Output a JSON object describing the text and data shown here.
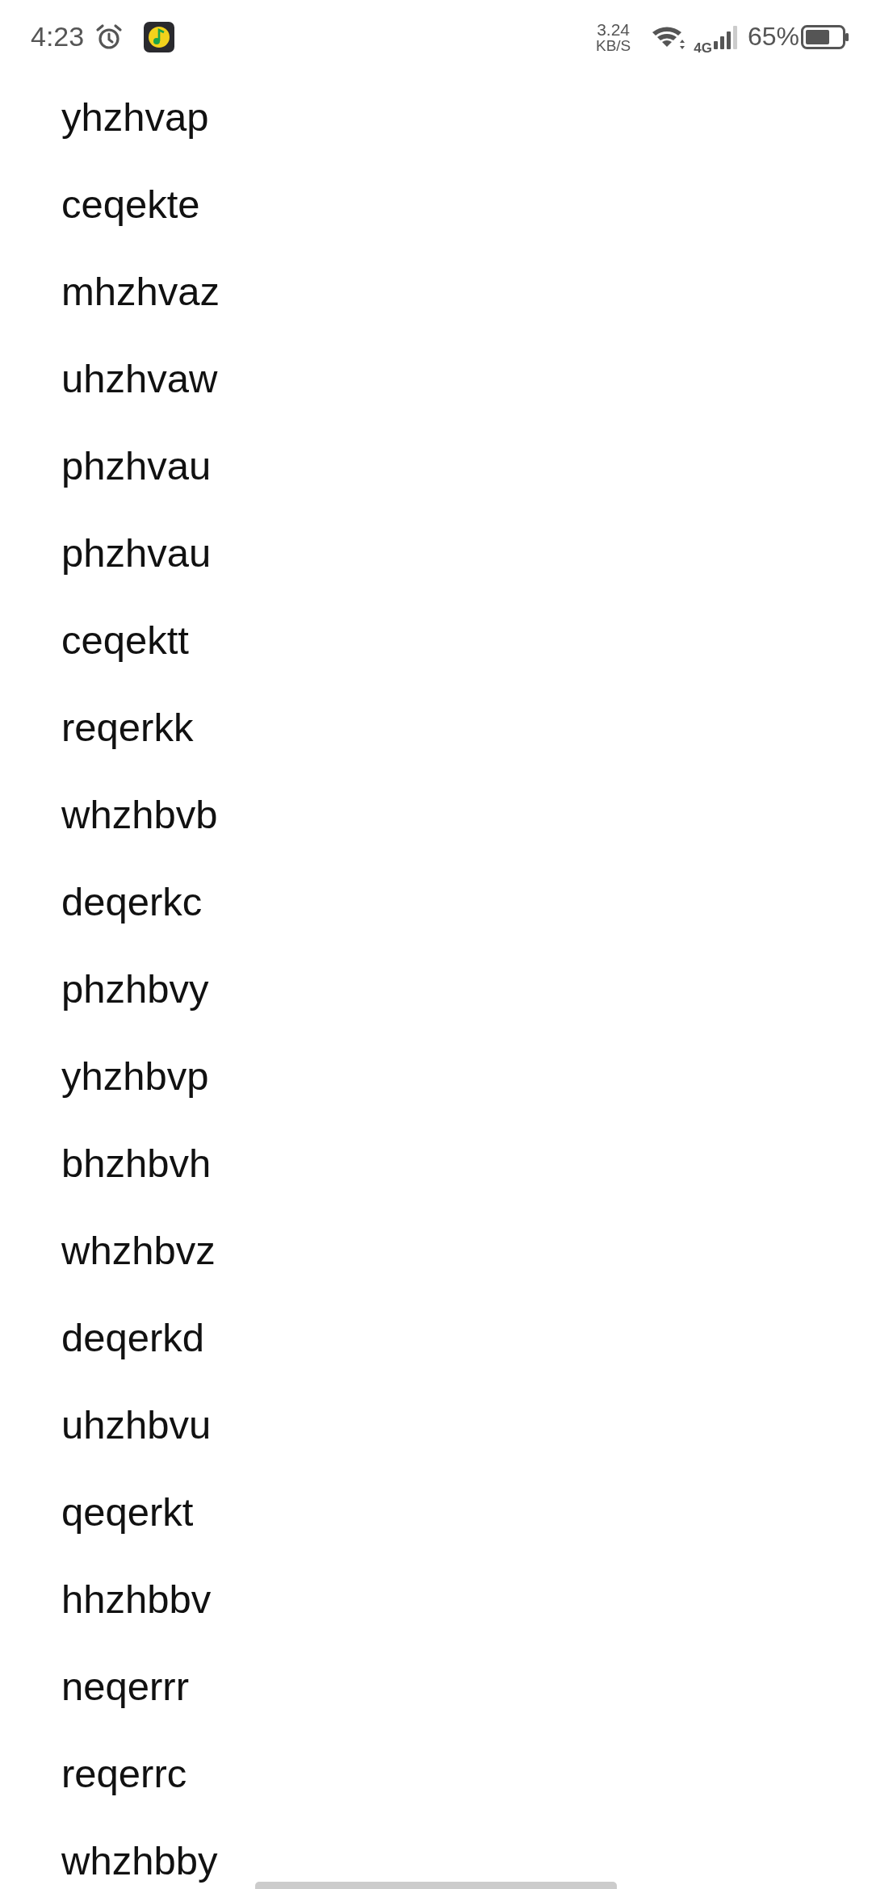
{
  "status_bar": {
    "time": "4:23",
    "net_speed_value": "3.24",
    "net_speed_unit": "KB/S",
    "network_type": "4G",
    "battery": "65%"
  },
  "items": [
    "yhzhvap",
    "ceqekte",
    "mhzhvaz",
    "uhzhvaw",
    "phzhvau",
    "phzhvau",
    "ceqektt",
    "reqerkk",
    "whzhbvb",
    "deqerkc",
    "phzhbvy",
    "yhzhbvp",
    "bhzhbvh",
    "whzhbvz",
    "deqerkd",
    "uhzhbvu",
    "qeqerkt",
    "hhzhbbv",
    "neqerrr",
    "reqerrc",
    "whzhbby"
  ]
}
